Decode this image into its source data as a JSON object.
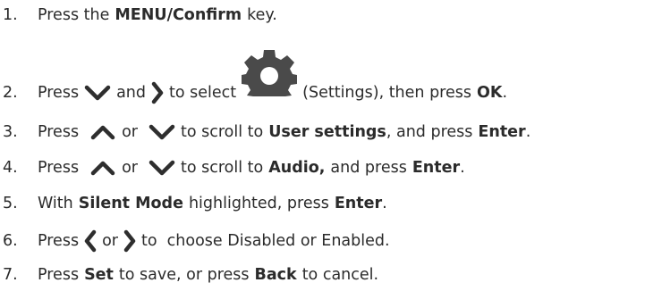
{
  "steps": [
    {
      "num": "1.",
      "press": "Press the",
      "key": "MENU/Confirm",
      "tail": "key."
    },
    {
      "num": "2.",
      "press": "Press",
      "and": "and",
      "to_select": "to select",
      "settings_paren": "(Settings), then press",
      "ok": "OK",
      "end": "."
    },
    {
      "num": "3.",
      "press": "Press",
      "or": "or",
      "to_scroll": "to scroll to",
      "target": "User settings",
      "and_press": ", and press",
      "enter": "Enter",
      "end": "."
    },
    {
      "num": "4.",
      "press": "Press",
      "or": "or",
      "to_scroll": "to scroll to",
      "target": "Audio,",
      "and_press": "and press",
      "enter": "Enter",
      "end": "."
    },
    {
      "num": "5.",
      "with": "With",
      "mode": "Silent Mode",
      "highlighted": "highlighted, press",
      "enter": "Enter",
      "end": "."
    },
    {
      "num": "6.",
      "press": "Press",
      "or": "or",
      "to_choose": "to  choose Disabled or Enabled."
    },
    {
      "num": "7.",
      "press": "Press",
      "set": "Set",
      "to_save": "to save, or press",
      "back": "Back",
      "to_cancel": "to cancel."
    }
  ],
  "icons": {
    "arrow_color": "#2e2e2e",
    "gear_color": "#4a4a4a"
  }
}
